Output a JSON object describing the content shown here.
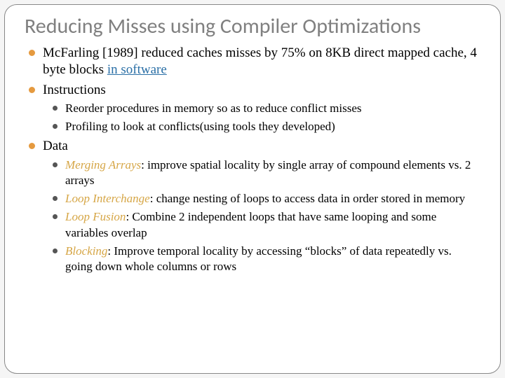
{
  "title": "Reducing Misses using Compiler Optimizations",
  "bullets": {
    "b1_pre": "McFarling [1989] reduced caches misses by 75% on 8KB direct mapped cache, 4 byte blocks ",
    "b1_link": "in software",
    "b2": "Instructions",
    "b2_1": "Reorder procedures in memory so as to reduce conflict misses",
    "b2_2": "Profiling to look at conflicts(using tools they developed)",
    "b3": "Data",
    "b3_1_term": "Merging Arrays",
    "b3_1_rest": ": improve spatial locality by single array of compound elements vs. 2 arrays",
    "b3_2_term": "Loop Interchange",
    "b3_2_rest": ": change nesting of loops to access data in order stored in memory",
    "b3_3_term": "Loop Fusion",
    "b3_3_rest": ": Combine 2 independent loops that have same looping and some variables overlap",
    "b3_4_term": "Blocking",
    "b3_4_rest": ": Improve temporal locality by accessing “blocks” of data repeatedly vs. going down whole columns or rows"
  }
}
